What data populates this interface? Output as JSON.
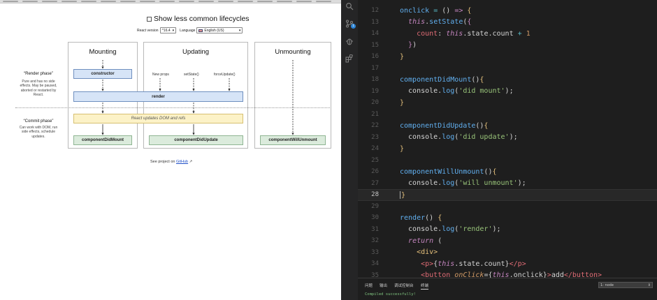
{
  "lifecycle_page": {
    "toggle_label": "Show less common lifecycles",
    "react_version_label": "React version",
    "react_version_value": "^16.4",
    "language_label": "Language",
    "language_value": "English (US)",
    "columns": {
      "mounting": "Mounting",
      "updating": "Updating",
      "unmounting": "Unmounting"
    },
    "render_phase": {
      "title": "“Render phase”",
      "desc": "Pure and has no side effects. May be paused, aborted or restarted by React."
    },
    "commit_phase": {
      "title": "“Commit phase”",
      "desc": "Can work with DOM, run side effects, schedule updates."
    },
    "triggers": {
      "new_props": "New props",
      "set_state": "setState()",
      "force_update": "forceUpdate()"
    },
    "boxes": {
      "constructor": "constructor",
      "render": "render",
      "react_updates": "React updates DOM and refs",
      "did_mount": "componentDidMount",
      "did_update": "componentDidUpdate",
      "will_unmount": "componentWillUnmount"
    },
    "footer_prefix": "See project on",
    "footer_link": "GitHub",
    "footer_icon": "external-link"
  },
  "editor": {
    "badge_count": "1",
    "lines": [
      {
        "n": "12"
      },
      {
        "n": "13"
      },
      {
        "n": "14"
      },
      {
        "n": "15"
      },
      {
        "n": "16"
      },
      {
        "n": "17"
      },
      {
        "n": "18"
      },
      {
        "n": "19"
      },
      {
        "n": "20"
      },
      {
        "n": "21"
      },
      {
        "n": "22"
      },
      {
        "n": "23"
      },
      {
        "n": "24"
      },
      {
        "n": "25"
      },
      {
        "n": "26"
      },
      {
        "n": "27"
      },
      {
        "n": "28"
      },
      {
        "n": "29"
      },
      {
        "n": "30"
      },
      {
        "n": "31"
      },
      {
        "n": "32"
      },
      {
        "n": "33"
      },
      {
        "n": "34"
      },
      {
        "n": "35"
      }
    ],
    "panel_tabs": [
      "问题",
      "输出",
      "调试控制台",
      "终端"
    ],
    "terminal_select": "1: node",
    "terminal_output": "Compiled successfully!"
  },
  "colors": {
    "editor_bg": "#1e1e1e",
    "keyword": "#c586c0",
    "function": "#61afef",
    "string": "#98c379",
    "number": "#d19a66"
  }
}
